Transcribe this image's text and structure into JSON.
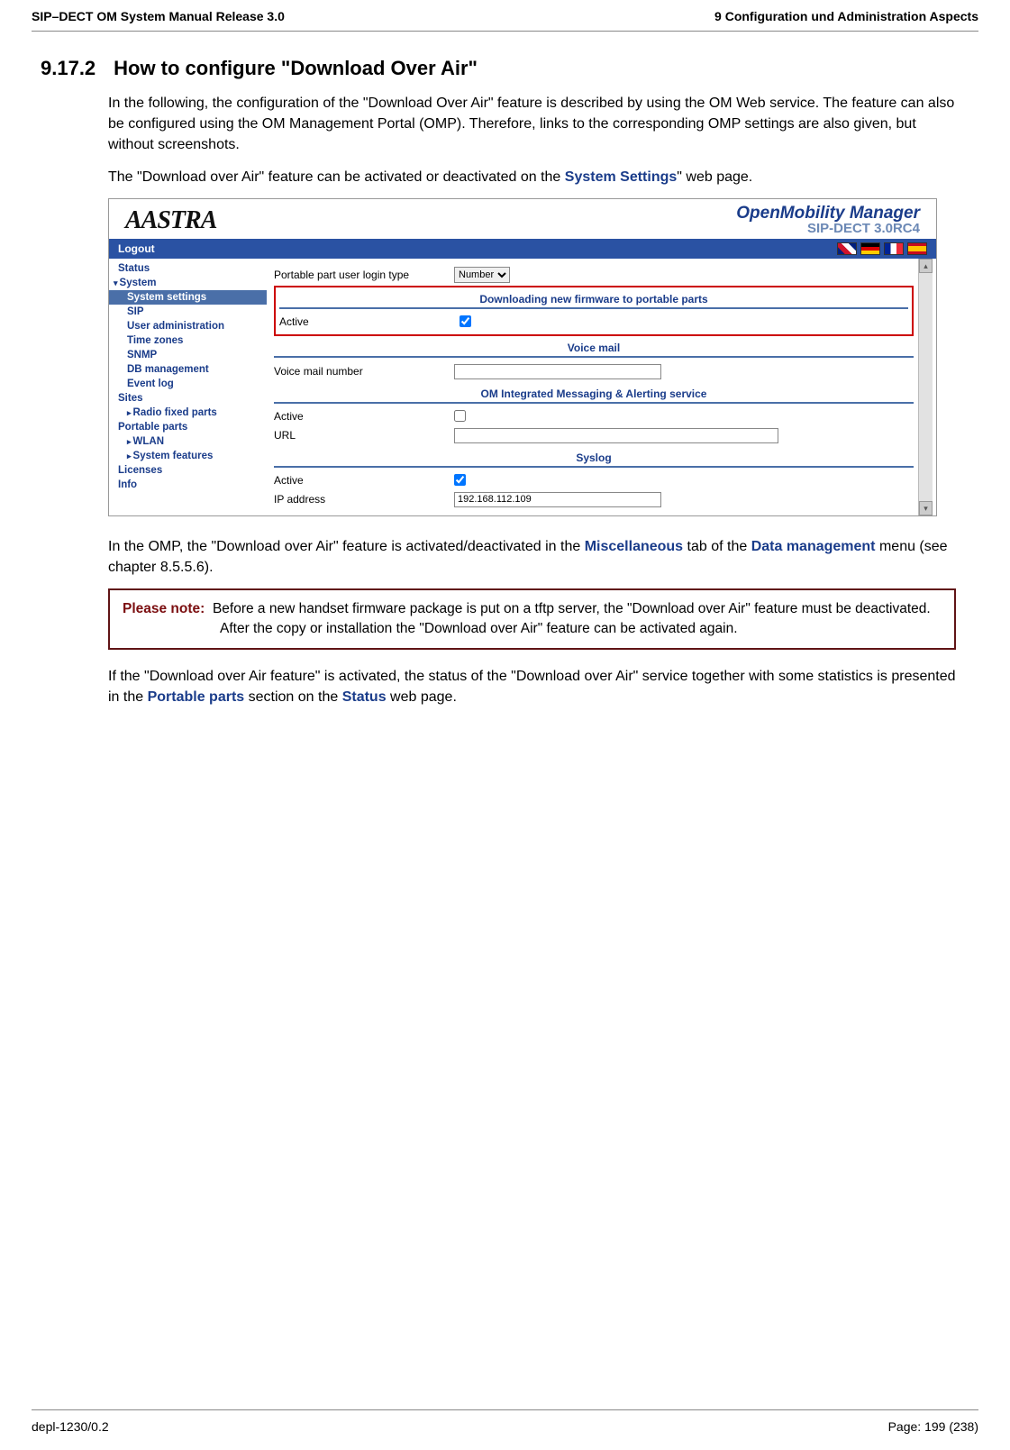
{
  "header": {
    "left": "SIP–DECT OM System Manual Release 3.0",
    "right": "9 Configuration und Administration Aspects"
  },
  "section": {
    "number": "9.17.2",
    "title": "How to configure \"Download Over Air\""
  },
  "para1": "In the following, the configuration of the \"Download Over Air\" feature is described by using the OM Web service. The feature can also be configured using the OM Management Portal (OMP). Therefore, links to the corresponding OMP settings are also given, but without screenshots.",
  "para2a": "The \"Download over Air\" feature can be activated or deactivated on the ",
  "para2link": "System Settings",
  "para2b": "\" web page.",
  "screenshot": {
    "brand": "AASTRA",
    "omm_title": "OpenMobility Manager",
    "omm_sub": "SIP-DECT 3.0RC4",
    "logout": "Logout",
    "nav": {
      "status": "Status",
      "system": "System",
      "system_settings": "System settings",
      "sip": "SIP",
      "user_admin": "User administration",
      "time_zones": "Time zones",
      "snmp": "SNMP",
      "db_mgmt": "DB management",
      "event_log": "Event log",
      "sites": "Sites",
      "radio": "Radio fixed parts",
      "portable": "Portable parts",
      "wlan": "WLAN",
      "sysfeat": "System features",
      "licenses": "Licenses",
      "info": "Info"
    },
    "main": {
      "login_type_label": "Portable part user login type",
      "login_type_value": "Number",
      "sec1": "Downloading new firmware to portable parts",
      "active": "Active",
      "sec2": "Voice mail",
      "voicemail_label": "Voice mail number",
      "sec3": "OM Integrated Messaging & Alerting service",
      "url_label": "URL",
      "sec4": "Syslog",
      "ip_label": "IP address",
      "ip_value": "192.168.112.109"
    }
  },
  "para3a": "In the OMP, the \"Download over Air\" feature is activated/deactivated in the ",
  "para3link1": "Miscellaneous",
  "para3b": " tab of the ",
  "para3link2": "Data management",
  "para3c": " menu (see chapter 8.5.5.6).",
  "note": {
    "label": "Please note:",
    "text": "Before a new handset firmware package is put on a tftp server, the \"Download over Air\" feature must be deactivated. After the copy or installation the \"Download over Air\" feature can be activated again."
  },
  "para4a": "If the \"Download over Air feature\" is activated, the status of the \"Download over Air\" service together with some statistics is presented in the ",
  "para4link1": "Portable parts",
  "para4b": " section on the ",
  "para4link2": "Status",
  "para4c": " web page.",
  "footer": {
    "left": "depl-1230/0.2",
    "right": "Page: 199 (238)"
  }
}
